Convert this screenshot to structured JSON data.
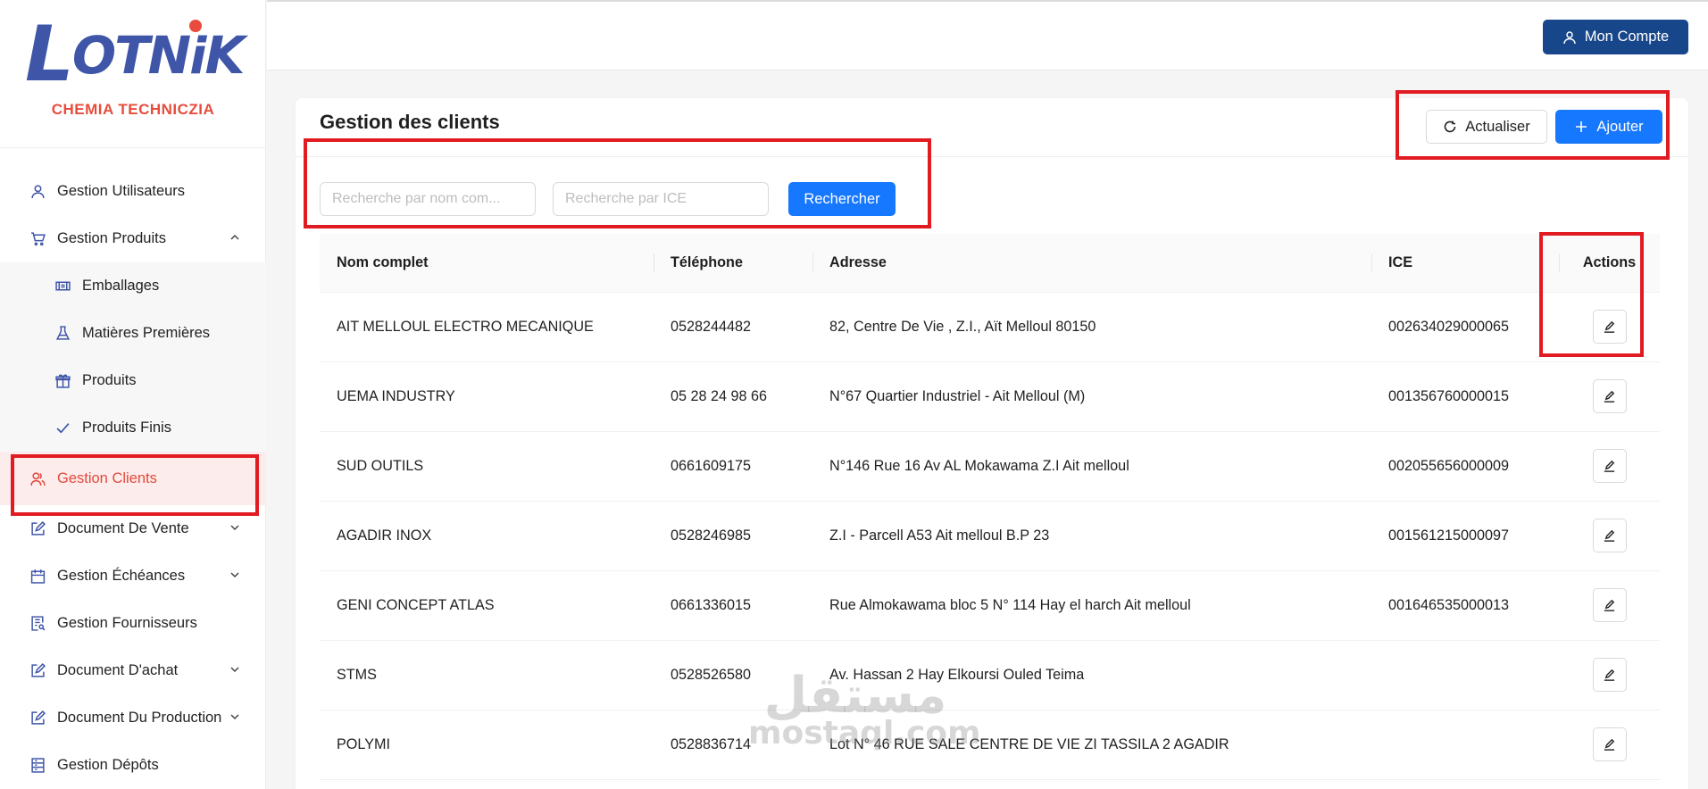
{
  "brand": {
    "logo_text": "LOTNiK",
    "subtitle": "CHEMIA TECHNICZIA",
    "colors": {
      "logo_blue": "#3f55a8",
      "logo_red": "#e74c3c"
    }
  },
  "sidebar": {
    "items": [
      {
        "label": "Gestion Utilisateurs",
        "icon": "user-icon"
      },
      {
        "label": "Gestion Produits",
        "icon": "cart-icon",
        "expanded": true,
        "children": [
          {
            "label": "Emballages",
            "icon": "package-icon"
          },
          {
            "label": "Matières Premières",
            "icon": "flask-icon"
          },
          {
            "label": "Produits",
            "icon": "gift-icon"
          },
          {
            "label": "Produits Finis",
            "icon": "check-icon"
          }
        ]
      },
      {
        "label": "Gestion Clients",
        "icon": "users-icon",
        "active": true
      },
      {
        "label": "Document De Vente",
        "icon": "edit-square-icon",
        "has_children": true
      },
      {
        "label": "Gestion Échéances",
        "icon": "calendar-icon",
        "has_children": true
      },
      {
        "label": "Gestion Fournisseurs",
        "icon": "document-search-icon"
      },
      {
        "label": "Document D'achat",
        "icon": "edit-square-icon",
        "has_children": true
      },
      {
        "label": "Document Du Production",
        "icon": "edit-square-icon",
        "has_children": true
      },
      {
        "label": "Gestion Dépôts",
        "icon": "database-icon"
      }
    ]
  },
  "topbar": {
    "account_label": "Mon Compte"
  },
  "page": {
    "title": "Gestion des clients",
    "refresh_label": "Actualiser",
    "add_label": "Ajouter",
    "search": {
      "name_placeholder": "Recherche par nom com...",
      "ice_placeholder": "Recherche par ICE",
      "name_value": "",
      "ice_value": "",
      "button_label": "Rechercher"
    }
  },
  "table": {
    "columns": [
      "Nom complet",
      "Téléphone",
      "Adresse",
      "ICE",
      "Actions"
    ],
    "rows": [
      {
        "name": "AIT MELLOUL ELECTRO MECANIQUE",
        "phone": "0528244482",
        "address": "82, Centre De Vie , Z.I., Aït Melloul 80150",
        "ice": "002634029000065"
      },
      {
        "name": "UEMA INDUSTRY",
        "phone": "05 28 24 98 66",
        "address": "N°67 Quartier Industriel - Ait Melloul (M)",
        "ice": "001356760000015"
      },
      {
        "name": "SUD OUTILS",
        "phone": "0661609175",
        "address": "N°146 Rue 16 Av AL Mokawama Z.I Ait melloul",
        "ice": "002055656000009"
      },
      {
        "name": "AGADIR INOX",
        "phone": "0528246985",
        "address": "Z.I - Parcell A53 Ait melloul B.P 23",
        "ice": "001561215000097"
      },
      {
        "name": "GENI CONCEPT ATLAS",
        "phone": "0661336015",
        "address": "Rue Almokawama bloc 5 N° 114 Hay el harch Ait melloul",
        "ice": "001646535000013"
      },
      {
        "name": "STMS",
        "phone": "0528526580",
        "address": "Av. Hassan 2 Hay Elkoursi Ouled Teima",
        "ice": ""
      },
      {
        "name": "POLYMI",
        "phone": "0528836714",
        "address": "Lot N° 46 RUE SALE CENTRE DE VIE ZI TASSILA 2 AGADIR",
        "ice": ""
      }
    ]
  },
  "watermark": {
    "arabic": "مستقل",
    "latin": "mostaql.com"
  },
  "colors": {
    "primary": "#1677ff",
    "account": "#17468a",
    "active_bg": "#fdecec",
    "active_text": "#e24a3b",
    "highlight": "#e11b22"
  }
}
